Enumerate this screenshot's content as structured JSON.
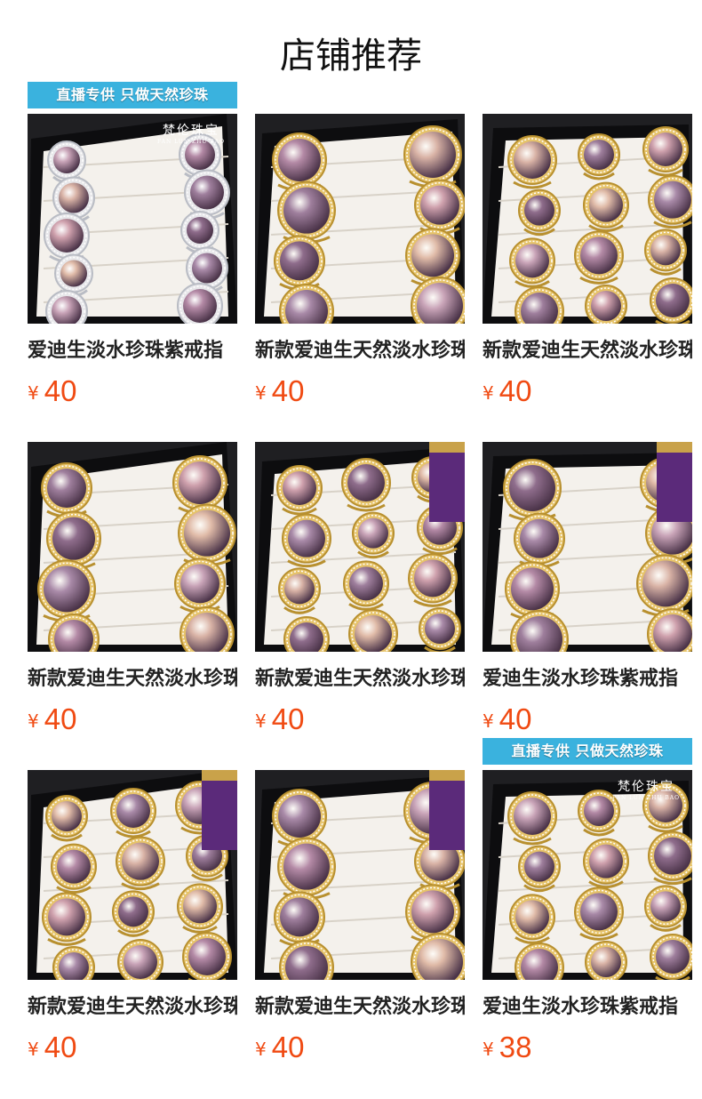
{
  "page": {
    "title": "店铺推荐"
  },
  "colors": {
    "price": "#f04a12",
    "banner": "#3ab2de",
    "title": "#111111"
  },
  "products": [
    {
      "title": "爱迪生淡水珍珠紫戒指",
      "currency": "¥",
      "price": "40",
      "logo_cn": "梵伦珠宝",
      "logo_en": "FAN LUN ZHU BAO",
      "banner": "直播专供 只做天然珍珠",
      "ring_color": "silver"
    },
    {
      "title": "新款爱迪生天然淡水珍珠戒指",
      "currency": "¥",
      "price": "40",
      "ring_color": "gold"
    },
    {
      "title": "新款爱迪生天然淡水珍珠戒指",
      "currency": "¥",
      "price": "40",
      "ring_color": "gold"
    },
    {
      "title": "新款爱迪生天然淡水珍珠戒指",
      "currency": "¥",
      "price": "40",
      "ring_color": "gold"
    },
    {
      "title": "新款爱迪生天然淡水珍珠戒指",
      "currency": "¥",
      "price": "40",
      "ring_color": "gold"
    },
    {
      "title": "爱迪生淡水珍珠紫戒指",
      "currency": "¥",
      "price": "40",
      "ring_color": "gold"
    },
    {
      "title": "新款爱迪生天然淡水珍珠戒指",
      "currency": "¥",
      "price": "40",
      "ring_color": "gold"
    },
    {
      "title": "新款爱迪生天然淡水珍珠戒指",
      "currency": "¥",
      "price": "40",
      "ring_color": "gold"
    },
    {
      "title": "爱迪生淡水珍珠紫戒指",
      "currency": "¥",
      "price": "38",
      "logo_cn": "梵伦珠宝",
      "logo_en": "FAN LUN ZHU BAO",
      "banner": "直播专供 只做天然珍珠",
      "ring_color": "gold"
    }
  ]
}
